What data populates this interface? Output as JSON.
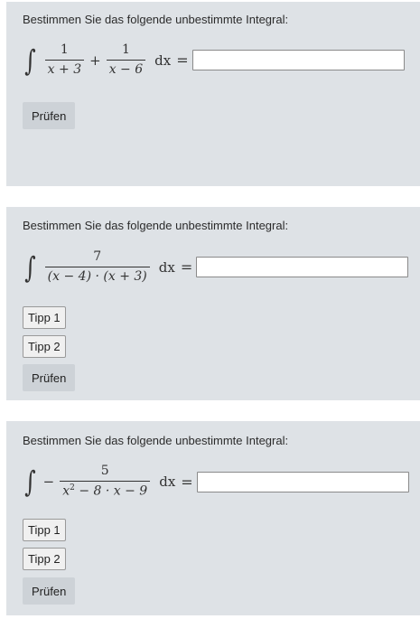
{
  "tasks": [
    {
      "prompt": "Bestimmen Sie das folgende unbestimmte Integral:",
      "formula": {
        "integral_sign": "∫",
        "terms": [
          {
            "numerator": "1",
            "denominator": "x + 3"
          },
          {
            "operator": "+"
          },
          {
            "numerator": "1",
            "denominator": "x − 6"
          }
        ],
        "differential": "dx",
        "equals": "="
      },
      "answer_value": "",
      "check_label": "Prüfen"
    },
    {
      "prompt": "Bestimmen Sie das folgende unbestimmte Integral:",
      "formula": {
        "integral_sign": "∫",
        "terms": [
          {
            "numerator": "7",
            "denominator": "(x − 4) · (x + 3)"
          }
        ],
        "differential": "dx",
        "equals": "="
      },
      "answer_value": "",
      "hints": [
        "Tipp 1",
        "Tipp 2"
      ],
      "check_label": "Prüfen"
    },
    {
      "prompt": "Bestimmen Sie das folgende unbestimmte Integral:",
      "formula": {
        "integral_sign": "∫",
        "sign": "−",
        "terms": [
          {
            "numerator": "5",
            "denominator_parts": [
              "x",
              "2",
              " − 8 · x − 9"
            ]
          }
        ],
        "differential": "dx",
        "equals": "="
      },
      "answer_value": "",
      "hints": [
        "Tipp 1",
        "Tipp 2"
      ],
      "check_label": "Prüfen"
    }
  ]
}
